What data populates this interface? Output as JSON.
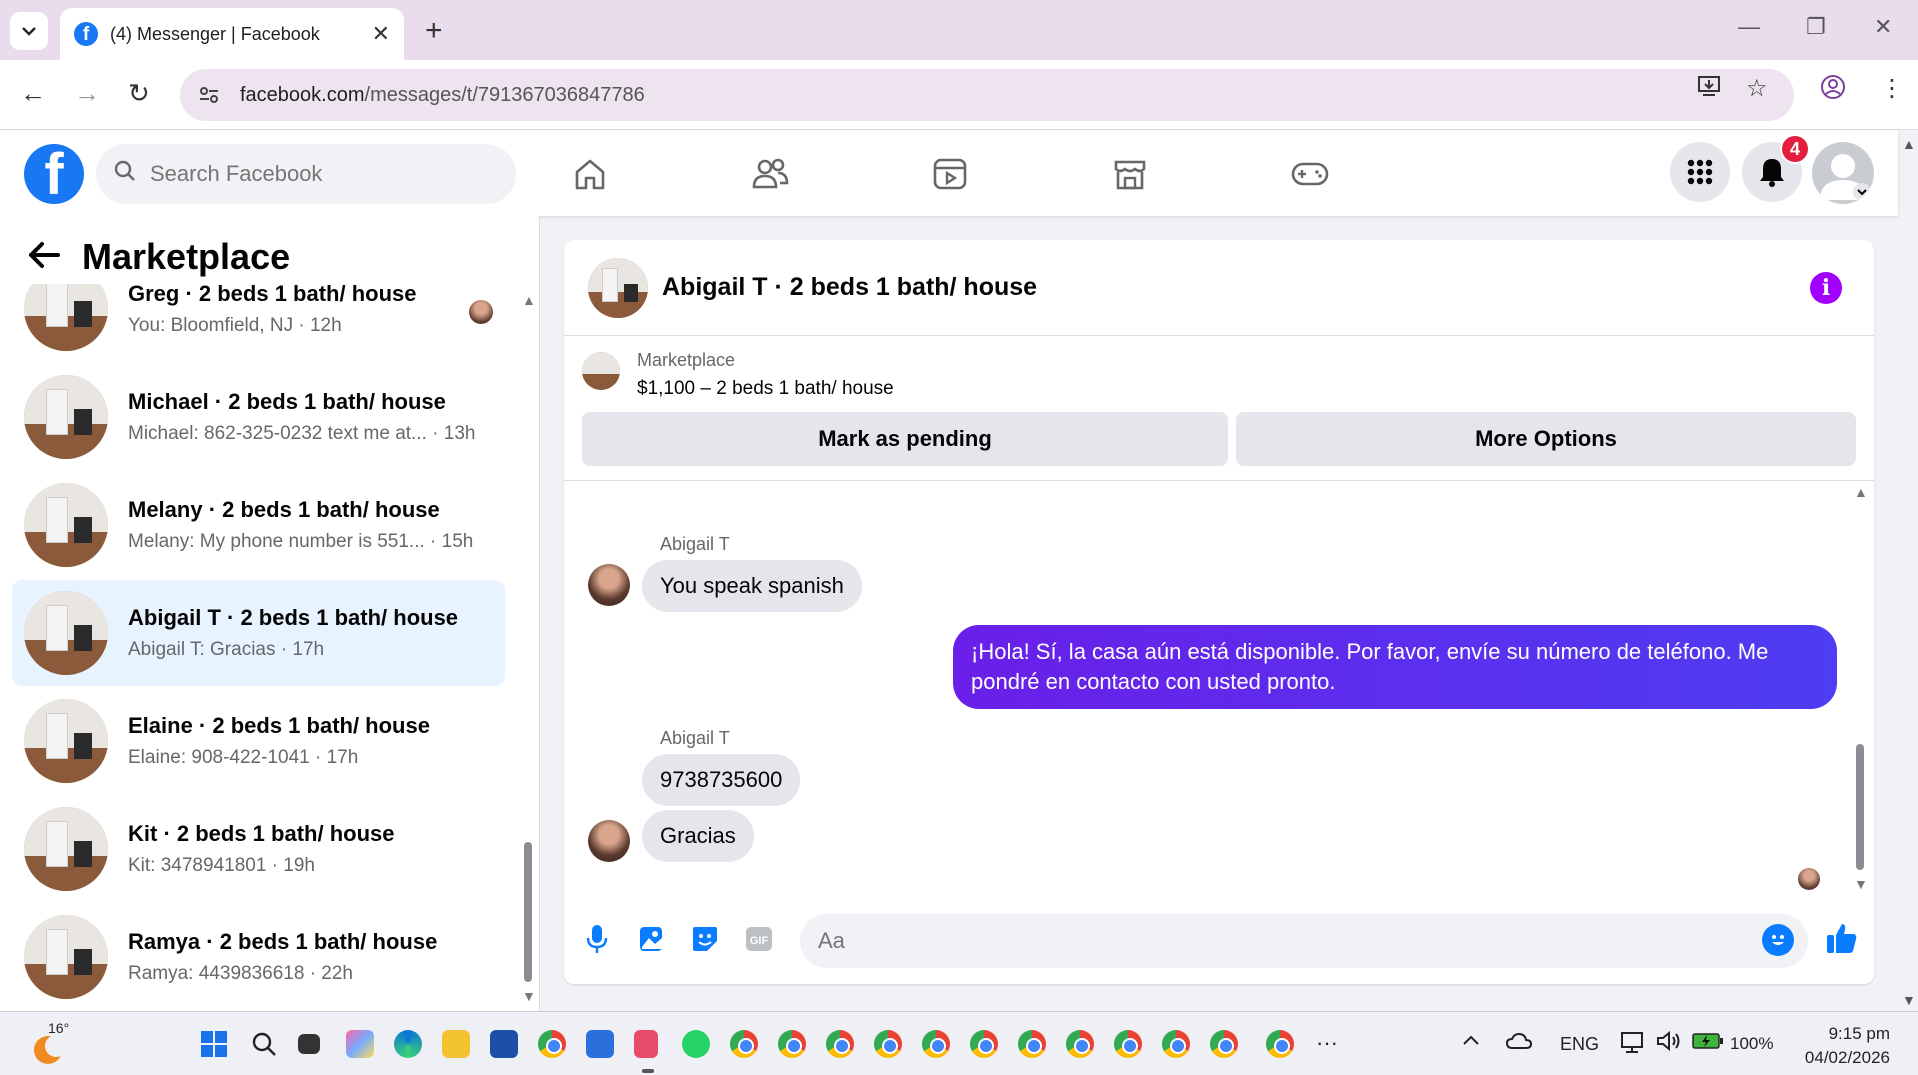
{
  "browser": {
    "tab_title": "(4) Messenger | Facebook",
    "url_domain": "facebook.com",
    "url_path": "/messages/t/791367036847786"
  },
  "fb": {
    "search_placeholder": "Search Facebook",
    "notification_count": "4",
    "brand_color": "#1877f2"
  },
  "sidebar": {
    "title": "Marketplace",
    "conversations": [
      {
        "name": "Greg · 2 beds 1 bath/ house",
        "preview": "You: Bloomfield, NJ · 12h"
      },
      {
        "name": "Michael · 2 beds 1 bath/ house",
        "preview": "Michael: 862-325-0232 text me at... · 13h"
      },
      {
        "name": "Melany · 2 beds 1 bath/ house",
        "preview": "Melany: My phone number is 551... · 15h"
      },
      {
        "name": "Abigail T · 2 beds 1 bath/ house",
        "preview": "Abigail T: Gracias · 17h"
      },
      {
        "name": "Elaine · 2 beds 1 bath/ house",
        "preview": "Elaine: 908-422-1041 · 17h"
      },
      {
        "name": "Kit · 2 beds 1 bath/ house",
        "preview": "Kit: 3478941801 · 19h"
      },
      {
        "name": "Ramya · 2 beds 1 bath/ house",
        "preview": "Ramya: 4439836618 · 22h"
      }
    ]
  },
  "chat": {
    "title": "Abigail T · 2 beds 1 bath/ house",
    "marketplace_label": "Marketplace",
    "listing": "$1,100 – 2 beds 1 bath/ house",
    "mark_pending": "Mark as pending",
    "more_options": "More Options",
    "messages": [
      {
        "sender": "Abigail T",
        "text": "You speak spanish"
      },
      {
        "sender": "me",
        "text": "¡Hola! Sí, la casa aún está disponible. Por favor, envíe su número de teléfono. Me pondré en contacto con usted pronto."
      },
      {
        "sender": "Abigail T",
        "text": "9738735600"
      },
      {
        "sender": "Abigail T",
        "text": "Gracias"
      }
    ],
    "composer_placeholder": "Aa",
    "outgoing_color": "#5b2bf0"
  },
  "taskbar": {
    "temperature": "16°",
    "language": "ENG",
    "battery": "100%",
    "time": "9:15 pm",
    "date": "04/02/2026"
  }
}
